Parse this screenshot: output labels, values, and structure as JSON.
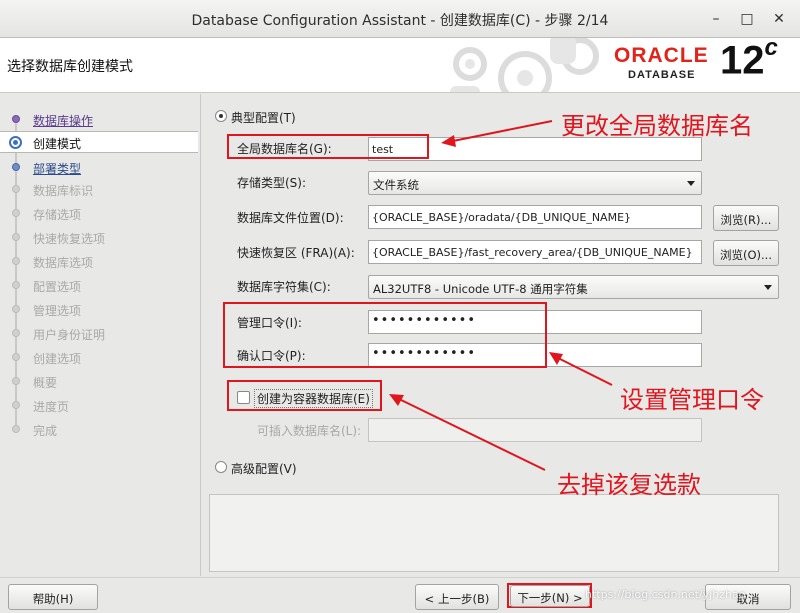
{
  "window": {
    "title": "Database Configuration Assistant - 创建数据库(C) - 步骤 2/14"
  },
  "header": {
    "title": "选择数据库创建模式",
    "brand": "ORACLE",
    "brand_sub": "DATABASE",
    "version": "12",
    "version_suffix": "c"
  },
  "nav": {
    "items": [
      {
        "label": "数据库操作",
        "state": "done"
      },
      {
        "label": "创建模式",
        "state": "current"
      },
      {
        "label": "部署类型",
        "state": "next"
      },
      {
        "label": "数据库标识",
        "state": "disabled"
      },
      {
        "label": "存储选项",
        "state": "disabled"
      },
      {
        "label": "快速恢复选项",
        "state": "disabled"
      },
      {
        "label": "数据库选项",
        "state": "disabled"
      },
      {
        "label": "配置选项",
        "state": "disabled"
      },
      {
        "label": "管理选项",
        "state": "disabled"
      },
      {
        "label": "用户身份证明",
        "state": "disabled"
      },
      {
        "label": "创建选项",
        "state": "disabled"
      },
      {
        "label": "概要",
        "state": "disabled"
      },
      {
        "label": "进度页",
        "state": "disabled"
      },
      {
        "label": "完成",
        "state": "disabled"
      }
    ]
  },
  "form": {
    "typical_label": "典型配置(T)",
    "global_db_name_label": "全局数据库名(G):",
    "global_db_name_value": "test",
    "storage_type_label": "存储类型(S):",
    "storage_type_value": "文件系统",
    "db_file_location_label": "数据库文件位置(D):",
    "db_file_location_value": "{ORACLE_BASE}/oradata/{DB_UNIQUE_NAME}",
    "browse_r": "浏览(R)...",
    "fra_label": "快速恢复区 (FRA)(A):",
    "fra_value": "{ORACLE_BASE}/fast_recovery_area/{DB_UNIQUE_NAME}",
    "browse_o": "浏览(O)...",
    "charset_label": "数据库字符集(C):",
    "charset_value": "AL32UTF8 - Unicode UTF-8 通用字符集",
    "admin_pw_label": "管理口令(I):",
    "admin_pw_value": "••••••••••••",
    "confirm_pw_label": "确认口令(P):",
    "confirm_pw_value": "••••••••••••",
    "container_db_label": "创建为容器数据库(E)",
    "container_db_checked": false,
    "pluggable_db_label": "可插入数据库名(L):",
    "advanced_label": "高级配置(V)"
  },
  "annotations": {
    "change_db_name": "更改全局数据库名",
    "set_admin_pw": "设置管理口令",
    "uncheck_option": "去掉该复选款"
  },
  "buttons": {
    "help": "帮助(H)",
    "back": "< 上一步(B)",
    "next": "下一步(N) >",
    "cancel": "取消"
  },
  "watermark": "https://blog.csdn.net/yjhzhao",
  "colors": {
    "annotation_red": "#e0161e",
    "oracle_red": "#e2231a"
  }
}
